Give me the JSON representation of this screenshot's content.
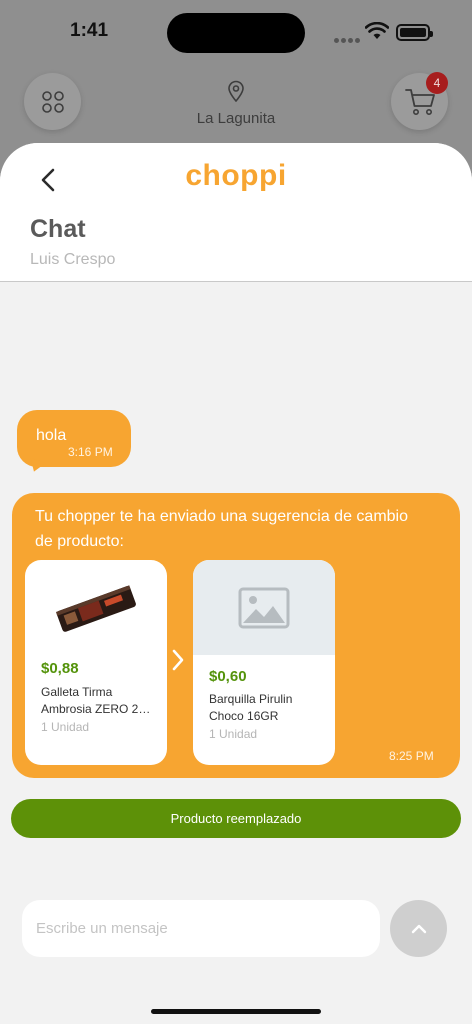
{
  "status_bar": {
    "time": "1:41"
  },
  "top_bar": {
    "location": "La Lagunita",
    "cart_count": "4"
  },
  "header": {
    "logo": "choppi",
    "title": "Chat",
    "subtitle": "Luis Crespo"
  },
  "messages": [
    {
      "text": "hola",
      "time": "3:16 PM"
    }
  ],
  "suggestion": {
    "text": "Tu chopper te ha enviado una sugerencia de cambio de producto:",
    "time": "8:25 PM",
    "original": {
      "price": "$0,88",
      "name_line1": "Galleta Tirma",
      "name_line2": "Ambrosia ZERO 21....",
      "unit": "1 Unidad"
    },
    "replacement": {
      "price": "$0,60",
      "name_line1": "Barquilla Pirulin",
      "name_line2": "Choco 16GR",
      "unit": "1 Unidad"
    }
  },
  "replaced_button": "Producto reemplazado",
  "input": {
    "placeholder": "Escribe un mensaje",
    "value": ""
  },
  "colors": {
    "brand": "#f7a531",
    "success": "#5d9108",
    "price": "#54930b",
    "badge": "#a71d1d"
  }
}
